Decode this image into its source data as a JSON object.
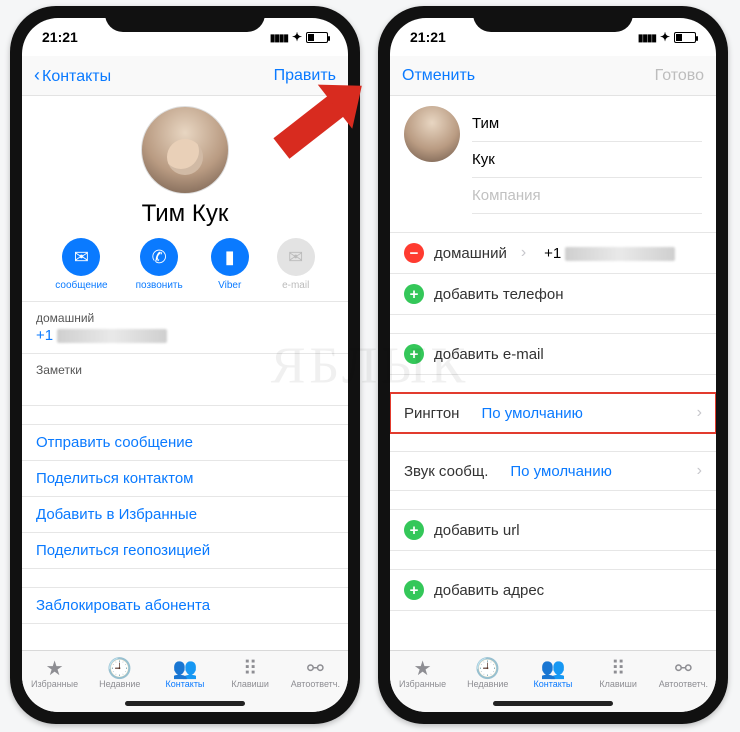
{
  "watermark": "ЯБЛЫК",
  "status": {
    "time": "21:21"
  },
  "left": {
    "nav": {
      "back": "Контакты",
      "edit": "Править"
    },
    "contact_name": "Тим  Кук",
    "actions": {
      "message": "сообщение",
      "call": "позвонить",
      "viber": "Viber",
      "email": "e-mail"
    },
    "phone": {
      "label": "домашний",
      "prefix": "+1"
    },
    "notes": "Заметки",
    "links": {
      "send_message": "Отправить сообщение",
      "share_contact": "Поделиться контактом",
      "add_favorite": "Добавить в Избранные",
      "share_location": "Поделиться геопозицией",
      "block": "Заблокировать абонента"
    }
  },
  "right": {
    "nav": {
      "cancel": "Отменить",
      "done": "Готово"
    },
    "fields": {
      "first": "Тим",
      "last": "Кук",
      "company_placeholder": "Компания"
    },
    "phone_row": {
      "label": "домашний",
      "prefix": "+1"
    },
    "add_phone": "добавить телефон",
    "add_email": "добавить e-mail",
    "ringtone": {
      "label": "Рингтон",
      "value": "По умолчанию"
    },
    "text_tone": {
      "label": "Звук сообщ.",
      "value": "По умолчанию"
    },
    "add_url": "добавить url",
    "add_address": "добавить адрес"
  },
  "tabs": {
    "favorites": "Избранные",
    "recents": "Недавние",
    "contacts": "Контакты",
    "keypad": "Клавиши",
    "voicemail": "Автоответч."
  }
}
